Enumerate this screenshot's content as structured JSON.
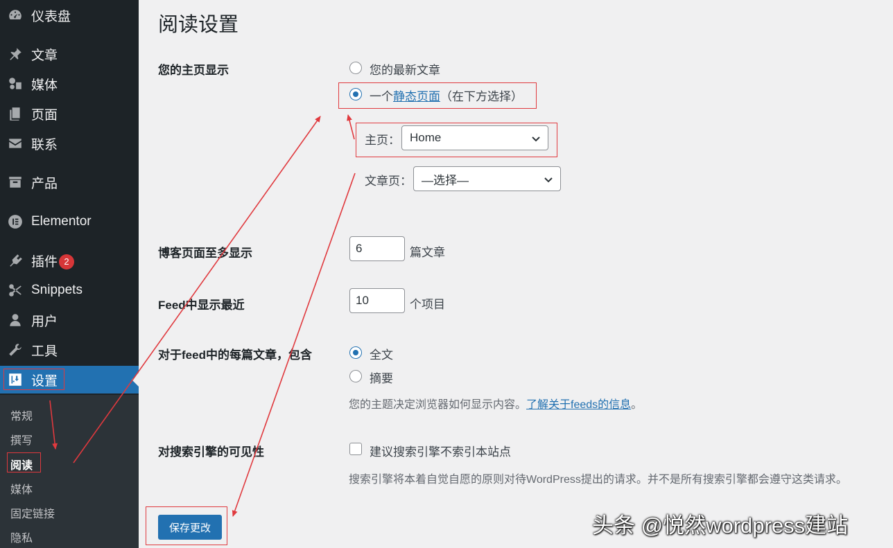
{
  "sidebar": {
    "items": [
      {
        "label": "仪表盘",
        "icon": "dashboard-icon"
      },
      {
        "label": "文章",
        "icon": "pin-icon"
      },
      {
        "label": "媒体",
        "icon": "media-icon"
      },
      {
        "label": "页面",
        "icon": "page-icon"
      },
      {
        "label": "联系",
        "icon": "mail-icon"
      },
      {
        "label": "产品",
        "icon": "archive-icon"
      },
      {
        "label": "Elementor",
        "icon": "elementor-icon"
      },
      {
        "label": "插件",
        "icon": "plugin-icon",
        "badge": "2"
      },
      {
        "label": "Snippets",
        "icon": "scissors-icon"
      },
      {
        "label": "用户",
        "icon": "user-icon"
      },
      {
        "label": "工具",
        "icon": "wrench-icon"
      },
      {
        "label": "设置",
        "icon": "settings-icon"
      }
    ],
    "submenu": [
      "常规",
      "撰写",
      "阅读",
      "媒体",
      "固定链接",
      "隐私"
    ]
  },
  "page": {
    "title": "阅读设置",
    "homepage": {
      "label": "您的主页显示",
      "option_latest": "您的最新文章",
      "option_static_prefix": "一个",
      "option_static_link": "静态页面",
      "option_static_suffix": "（在下方选择）",
      "front_label": "主页：",
      "front_value": "Home",
      "posts_label": "文章页：",
      "posts_value": "—选择—"
    },
    "blog_pages": {
      "label": "博客页面至多显示",
      "value": "6",
      "unit": "篇文章"
    },
    "feed_recent": {
      "label": "Feed中显示最近",
      "value": "10",
      "unit": "个项目"
    },
    "feed_content": {
      "label": "对于feed中的每篇文章，包含",
      "option_full": "全文",
      "option_excerpt": "摘要",
      "desc_prefix": "您的主题决定浏览器如何显示内容。",
      "desc_link": "了解关于feeds的信息",
      "desc_suffix": "。"
    },
    "search_visibility": {
      "label": "对搜索引擎的可见性",
      "checkbox_label": "建议搜索引擎不索引本站点",
      "desc": "搜索引擎将本着自觉自愿的原则对待WordPress提出的请求。并不是所有搜索引擎都会遵守这类请求。"
    },
    "save_label": "保存更改"
  },
  "watermark": "头条 @悦然wordpress建站",
  "colors": {
    "sidebar_bg": "#1d2327",
    "accent": "#2271b1",
    "annotation": "#e0393e"
  }
}
